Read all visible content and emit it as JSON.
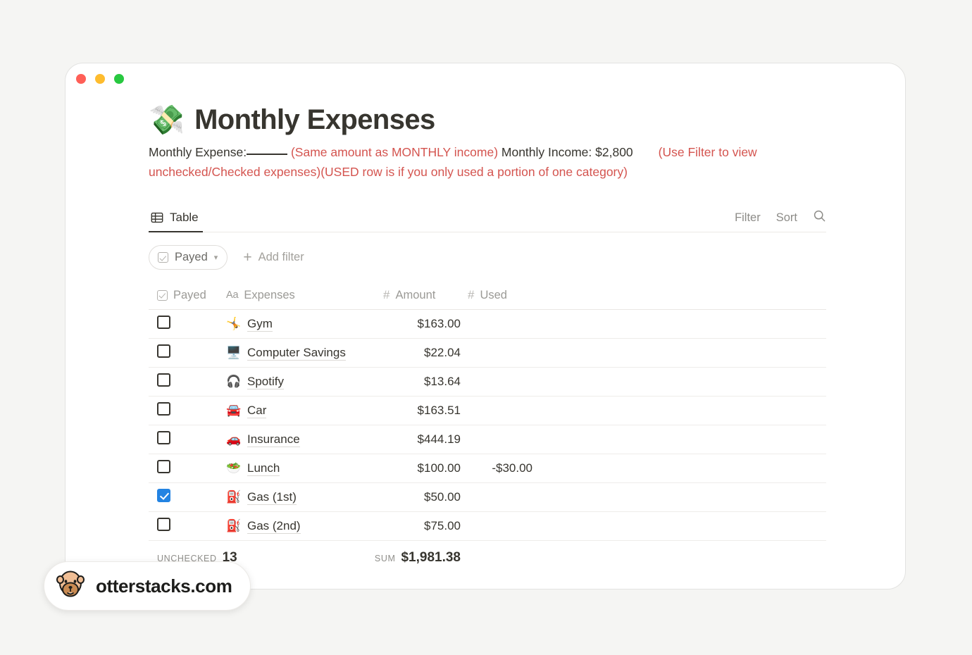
{
  "window": {
    "traffic_lights": [
      "close",
      "minimize",
      "maximize"
    ],
    "colors": {
      "close": "#ff5f57",
      "minimize": "#febc2e",
      "maximize": "#28c840"
    }
  },
  "header": {
    "emoji": "💸",
    "title": "Monthly Expenses",
    "subtitle": {
      "part1": "Monthly Expense:",
      "part2_red": "(Same amount as MONTHLY income)",
      "part3": "Monthly Income: $2,800",
      "part4_red": "(Use Filter to view unchecked/Checked expenses)",
      "part5_red": "(USED row is if you only used a portion of one category)"
    }
  },
  "view_bar": {
    "tab_label": "Table",
    "tab_icon": "table-icon",
    "actions": [
      "Filter",
      "Sort"
    ],
    "search_icon": "search-icon"
  },
  "filter_row": {
    "chip_label": "Payed",
    "chip_icon": "checkbox-icon",
    "chip_chevron": "chevron-down-icon",
    "add_filter_label": "Add filter",
    "add_filter_icon": "plus-icon"
  },
  "table": {
    "columns": [
      {
        "label": "Payed",
        "icon": "checkbox-icon"
      },
      {
        "label": "Expenses",
        "icon": "aa-text-icon"
      },
      {
        "label": "Amount",
        "icon": "number-icon"
      },
      {
        "label": "Used",
        "icon": "number-icon"
      }
    ],
    "rows": [
      {
        "payed": false,
        "emoji": "🤸",
        "name": "Gym",
        "amount": "$163.00",
        "used": ""
      },
      {
        "payed": false,
        "emoji": "🖥️",
        "name": "Computer Savings",
        "amount": "$22.04",
        "used": ""
      },
      {
        "payed": false,
        "emoji": "🎧",
        "name": "Spotify",
        "amount": "$13.64",
        "used": ""
      },
      {
        "payed": false,
        "emoji": "🚘",
        "name": "Car",
        "amount": "$163.51",
        "used": ""
      },
      {
        "payed": false,
        "emoji": "🚗",
        "name": "Insurance",
        "amount": "$444.19",
        "used": ""
      },
      {
        "payed": false,
        "emoji": "🥗",
        "name": "Lunch",
        "amount": "$100.00",
        "used": "-$30.00"
      },
      {
        "payed": true,
        "emoji": "⛽",
        "name": "Gas (1st)",
        "amount": "$50.00",
        "used": ""
      },
      {
        "payed": false,
        "emoji": "⛽",
        "name": "Gas (2nd)",
        "amount": "$75.00",
        "used": ""
      }
    ],
    "footer": {
      "unchecked_label": "UNCHECKED",
      "unchecked_value": "13",
      "sum_label": "SUM",
      "sum_value": "$1,981.38"
    }
  },
  "watermark": {
    "text": "otterstacks.com",
    "icon": "otter-logo"
  },
  "colors": {
    "accent_blue": "#2383e2",
    "annotation_red": "#d4544f",
    "text": "#37352f",
    "muted": "#9b9a96",
    "page_bg": "#f5f5f3"
  }
}
